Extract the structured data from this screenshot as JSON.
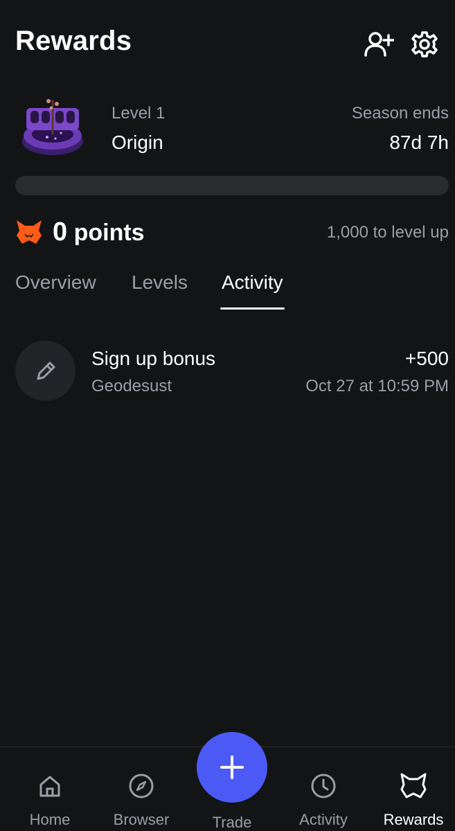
{
  "header": {
    "title": "Rewards",
    "add_friend_icon": "add-user-icon",
    "settings_icon": "gear-icon"
  },
  "level": {
    "art_icon": "season-level-artwork",
    "label": "Level 1",
    "name": "Origin",
    "season_label": "Season ends",
    "season_value": "87d 7h",
    "progress_fraction": 0
  },
  "points": {
    "icon": "fox-icon",
    "value": "0",
    "unit": "points",
    "to_level_up": "1,000 to level up"
  },
  "tabs": [
    {
      "label": "Overview",
      "active": false
    },
    {
      "label": "Levels",
      "active": false
    },
    {
      "label": "Activity",
      "active": true
    }
  ],
  "activity": [
    {
      "icon": "pencil-icon",
      "title": "Sign up bonus",
      "subtitle": "Geodesust",
      "amount": "+500",
      "time": "Oct 27 at 10:59 PM"
    }
  ],
  "bottom_nav": [
    {
      "label": "Home",
      "icon": "home-icon",
      "active": false
    },
    {
      "label": "Browser",
      "icon": "compass-icon",
      "active": false
    },
    {
      "label": "Trade",
      "icon": "plus-icon",
      "active": false
    },
    {
      "label": "Activity",
      "icon": "clock-icon",
      "active": false
    },
    {
      "label": "Rewards",
      "icon": "rewards-icon",
      "active": true
    }
  ],
  "colors": {
    "background": "#131416",
    "accent_orange": "#ff5c16",
    "trade_blue": "#4c5af5",
    "muted_text": "#9b9fa6"
  }
}
